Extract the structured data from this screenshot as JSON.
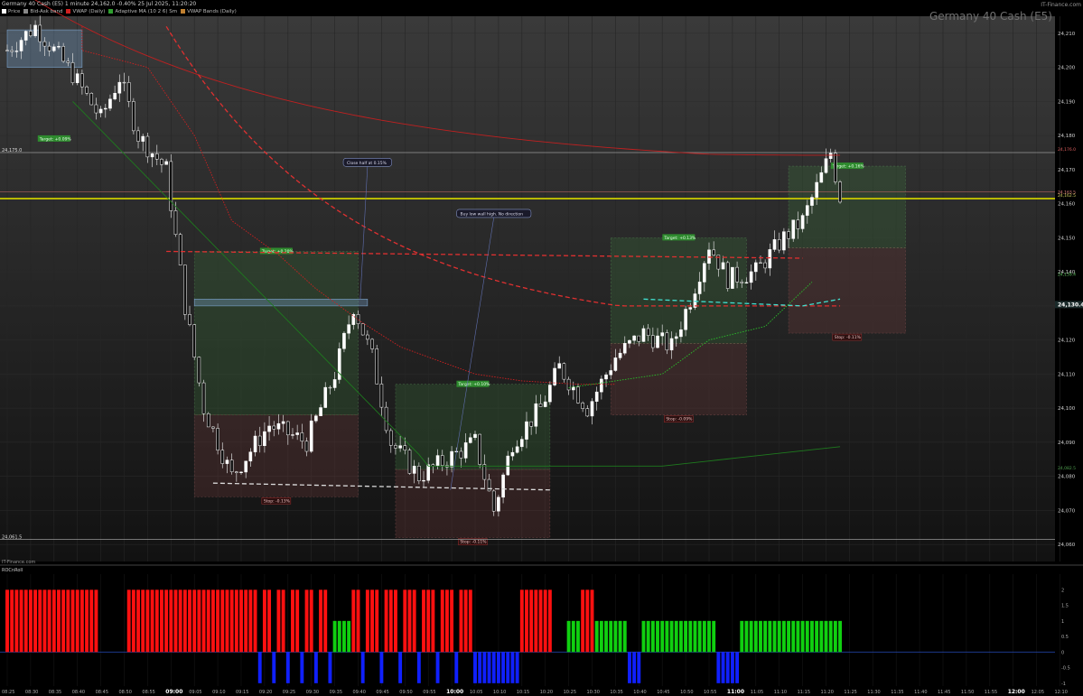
{
  "header": {
    "title": "Germany 40 Cash (E5) 1 minute 24,162.0 -0.40% 25 Jul 2025, 11:20:20",
    "brand": "IT-Finance.com",
    "instrument": "Germany 40 Cash (E5)",
    "legend": [
      {
        "label": "Price",
        "color": "#ffffff"
      },
      {
        "label": "Bid-Ask band",
        "color": "#888888"
      },
      {
        "label": "VWAP (Daily)",
        "color": "#d02020"
      },
      {
        "label": "Adaptive MA (10 2 6) Sm",
        "color": "#30a030"
      },
      {
        "label": "VWAP Bands (Daily)",
        "color": "#c08030"
      }
    ],
    "lower_panel_label": "ROCnRoll",
    "lower_brand": "IT-Finance.com"
  },
  "chart_data": {
    "type": "candlestick",
    "yticks": [
      "24,210",
      "24,200",
      "24,190",
      "24,180",
      "24,170",
      "24,160",
      "24,150",
      "24,140",
      "24,130",
      "24,120",
      "24,110",
      "24,100",
      "24,090",
      "24,080",
      "24,070",
      "24,060"
    ],
    "ytick_values": [
      24210,
      24200,
      24190,
      24180,
      24170,
      24160,
      24150,
      24140,
      24130,
      24120,
      24110,
      24100,
      24090,
      24080,
      24070,
      24060
    ],
    "xticks": [
      "08:25",
      "08:30",
      "08:35",
      "08:40",
      "08:45",
      "08:50",
      "08:55",
      "09:00",
      "09:05",
      "09:10",
      "09:15",
      "09:20",
      "09:25",
      "09:30",
      "09:35",
      "09:40",
      "09:45",
      "09:50",
      "09:55",
      "10:00",
      "10:05",
      "10:10",
      "10:15",
      "10:20",
      "10:25",
      "10:30",
      "10:35",
      "10:40",
      "10:45",
      "10:50",
      "10:55",
      "11:00",
      "11:05",
      "11:10",
      "11:15",
      "11:20",
      "11:25",
      "11:30",
      "11:35",
      "11:40",
      "11:45",
      "11:50",
      "11:55",
      "12:00",
      "12:05",
      "12:10"
    ],
    "bold_xticks": [
      "09:00",
      "10:00",
      "11:00",
      "12:00"
    ],
    "ylim": [
      24055,
      24215
    ],
    "price_labels": {
      "left_upper": "24,175.0",
      "left_lower": "24,061.5",
      "right_current": "24,130.4",
      "right_levels": [
        "24,176.0",
        "24,163.5",
        "24,162.5",
        "24,139.4",
        "24,082.5"
      ]
    },
    "zones": [
      {
        "t_start": 0,
        "t_end": 20,
        "entry": 24210,
        "target": 24179,
        "target_label": "Target: +0.09%",
        "stop_label": ""
      },
      {
        "t_start": 40,
        "t_end": 75,
        "entry": 24098,
        "target": 24146,
        "stop": 24074,
        "target_label": "Target: +0.20%",
        "stop_label": "Stop: -0.13%"
      },
      {
        "t_start": 83,
        "t_end": 116,
        "entry": 24082,
        "target": 24107,
        "stop": 24062,
        "target_label": "Target: +0.10%",
        "stop_label": "Stop: -0.11%"
      },
      {
        "t_start": 129,
        "t_end": 158,
        "entry": 24119,
        "target": 24150,
        "stop": 24098,
        "target_label": "Target: +0.13%",
        "stop_label": "Stop: -0.09%"
      },
      {
        "t_start": 167,
        "t_end": 192,
        "entry": 24147,
        "target": 24171,
        "stop": 24122,
        "target_label": "Target: +0.16%",
        "stop_label": "Stop: -0.11%"
      }
    ],
    "annotations": [
      {
        "text": "Close half at 0.15%",
        "t": 77,
        "price": 24172
      },
      {
        "text": "Buy low wall high. No direction",
        "t": 104,
        "price": 24157
      }
    ],
    "indicator": {
      "name": "ROCnRoll",
      "yticks": [
        "2",
        "1.5",
        "1",
        "0.5",
        "0",
        "-0.5",
        "-1"
      ],
      "ytick_values": [
        2,
        1.5,
        1,
        0.5,
        0,
        -0.5,
        -1
      ],
      "ylim": [
        -1.15,
        2.3
      ]
    }
  }
}
